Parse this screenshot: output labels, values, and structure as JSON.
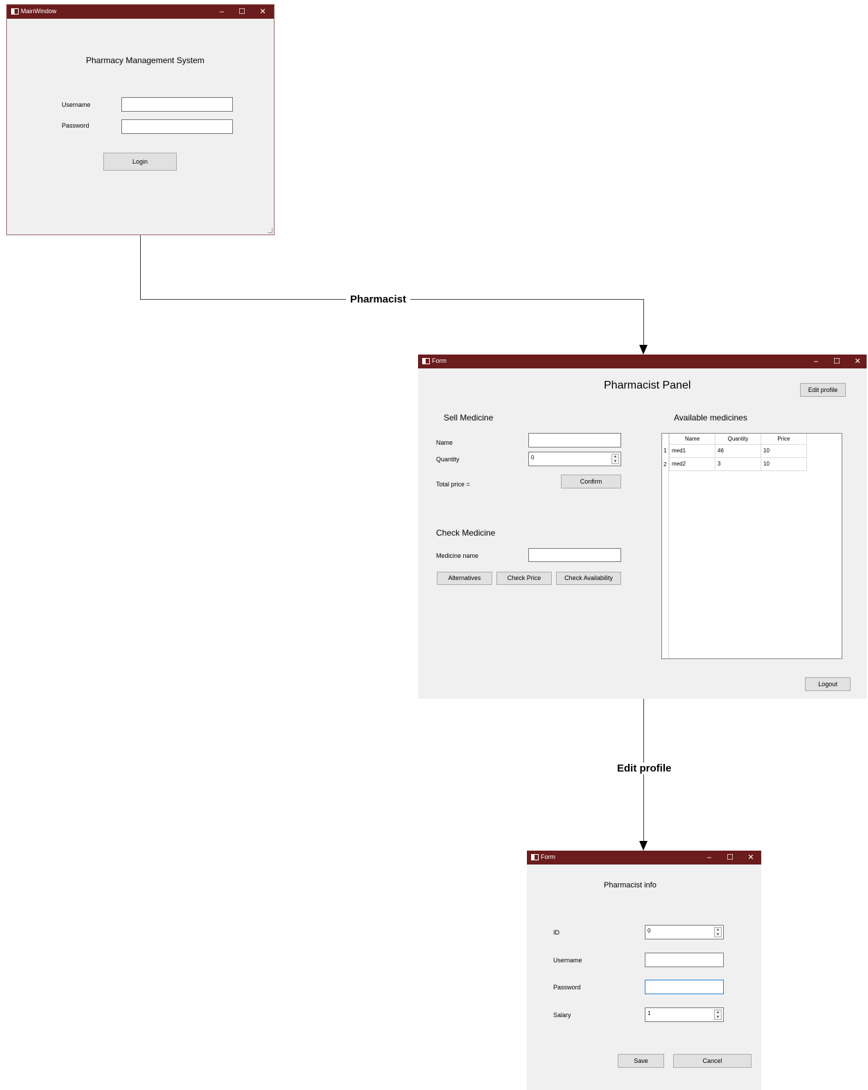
{
  "main_window": {
    "title": "MainWindow",
    "controls": {
      "minimize": "–",
      "maximize": "☐",
      "close": "✕"
    },
    "heading": "Pharmacy Management System",
    "username_label": "Username",
    "password_label": "Password",
    "username_value": "",
    "password_value": "",
    "login_button": "Login"
  },
  "flow": {
    "pharmacist_label": "Pharmacist",
    "edit_profile_label": "Edit profile"
  },
  "panel_window": {
    "title": "Form",
    "controls": {
      "minimize": "–",
      "maximize": "☐",
      "close": "✕"
    },
    "heading": "Pharmacist Panel",
    "edit_profile_button": "Edit profile",
    "sell": {
      "heading": "Sell Medicine",
      "name_label": "Name",
      "name_value": "",
      "quantity_label": "Quantity",
      "quantity_value": "0",
      "total_label": "Total price =",
      "confirm_button": "Confirm"
    },
    "check": {
      "heading": "Check Medicine",
      "medicine_name_label": "Medicine name",
      "medicine_name_value": "",
      "alternatives_button": "Alternatives",
      "check_price_button": "Check Price",
      "check_availability_button": "Check Availability"
    },
    "available": {
      "heading": "Available medicines",
      "columns": [
        "Name",
        "Quantity",
        "Price"
      ],
      "rows": [
        {
          "num": "1",
          "name": "med1",
          "quantity": "46",
          "price": "10"
        },
        {
          "num": "2",
          "name": "med2",
          "quantity": "3",
          "price": "10"
        }
      ]
    },
    "logout_button": "Logout"
  },
  "info_window": {
    "title": "Form",
    "controls": {
      "minimize": "–",
      "maximize": "☐",
      "close": "✕"
    },
    "heading": "Pharmacist info",
    "id_label": "ID",
    "id_value": "0",
    "username_label": "Username",
    "username_value": "",
    "password_label": "Password",
    "password_value": "",
    "salary_label": "Salary",
    "salary_value": "1",
    "save_button": "Save",
    "cancel_button": "Cancel"
  }
}
